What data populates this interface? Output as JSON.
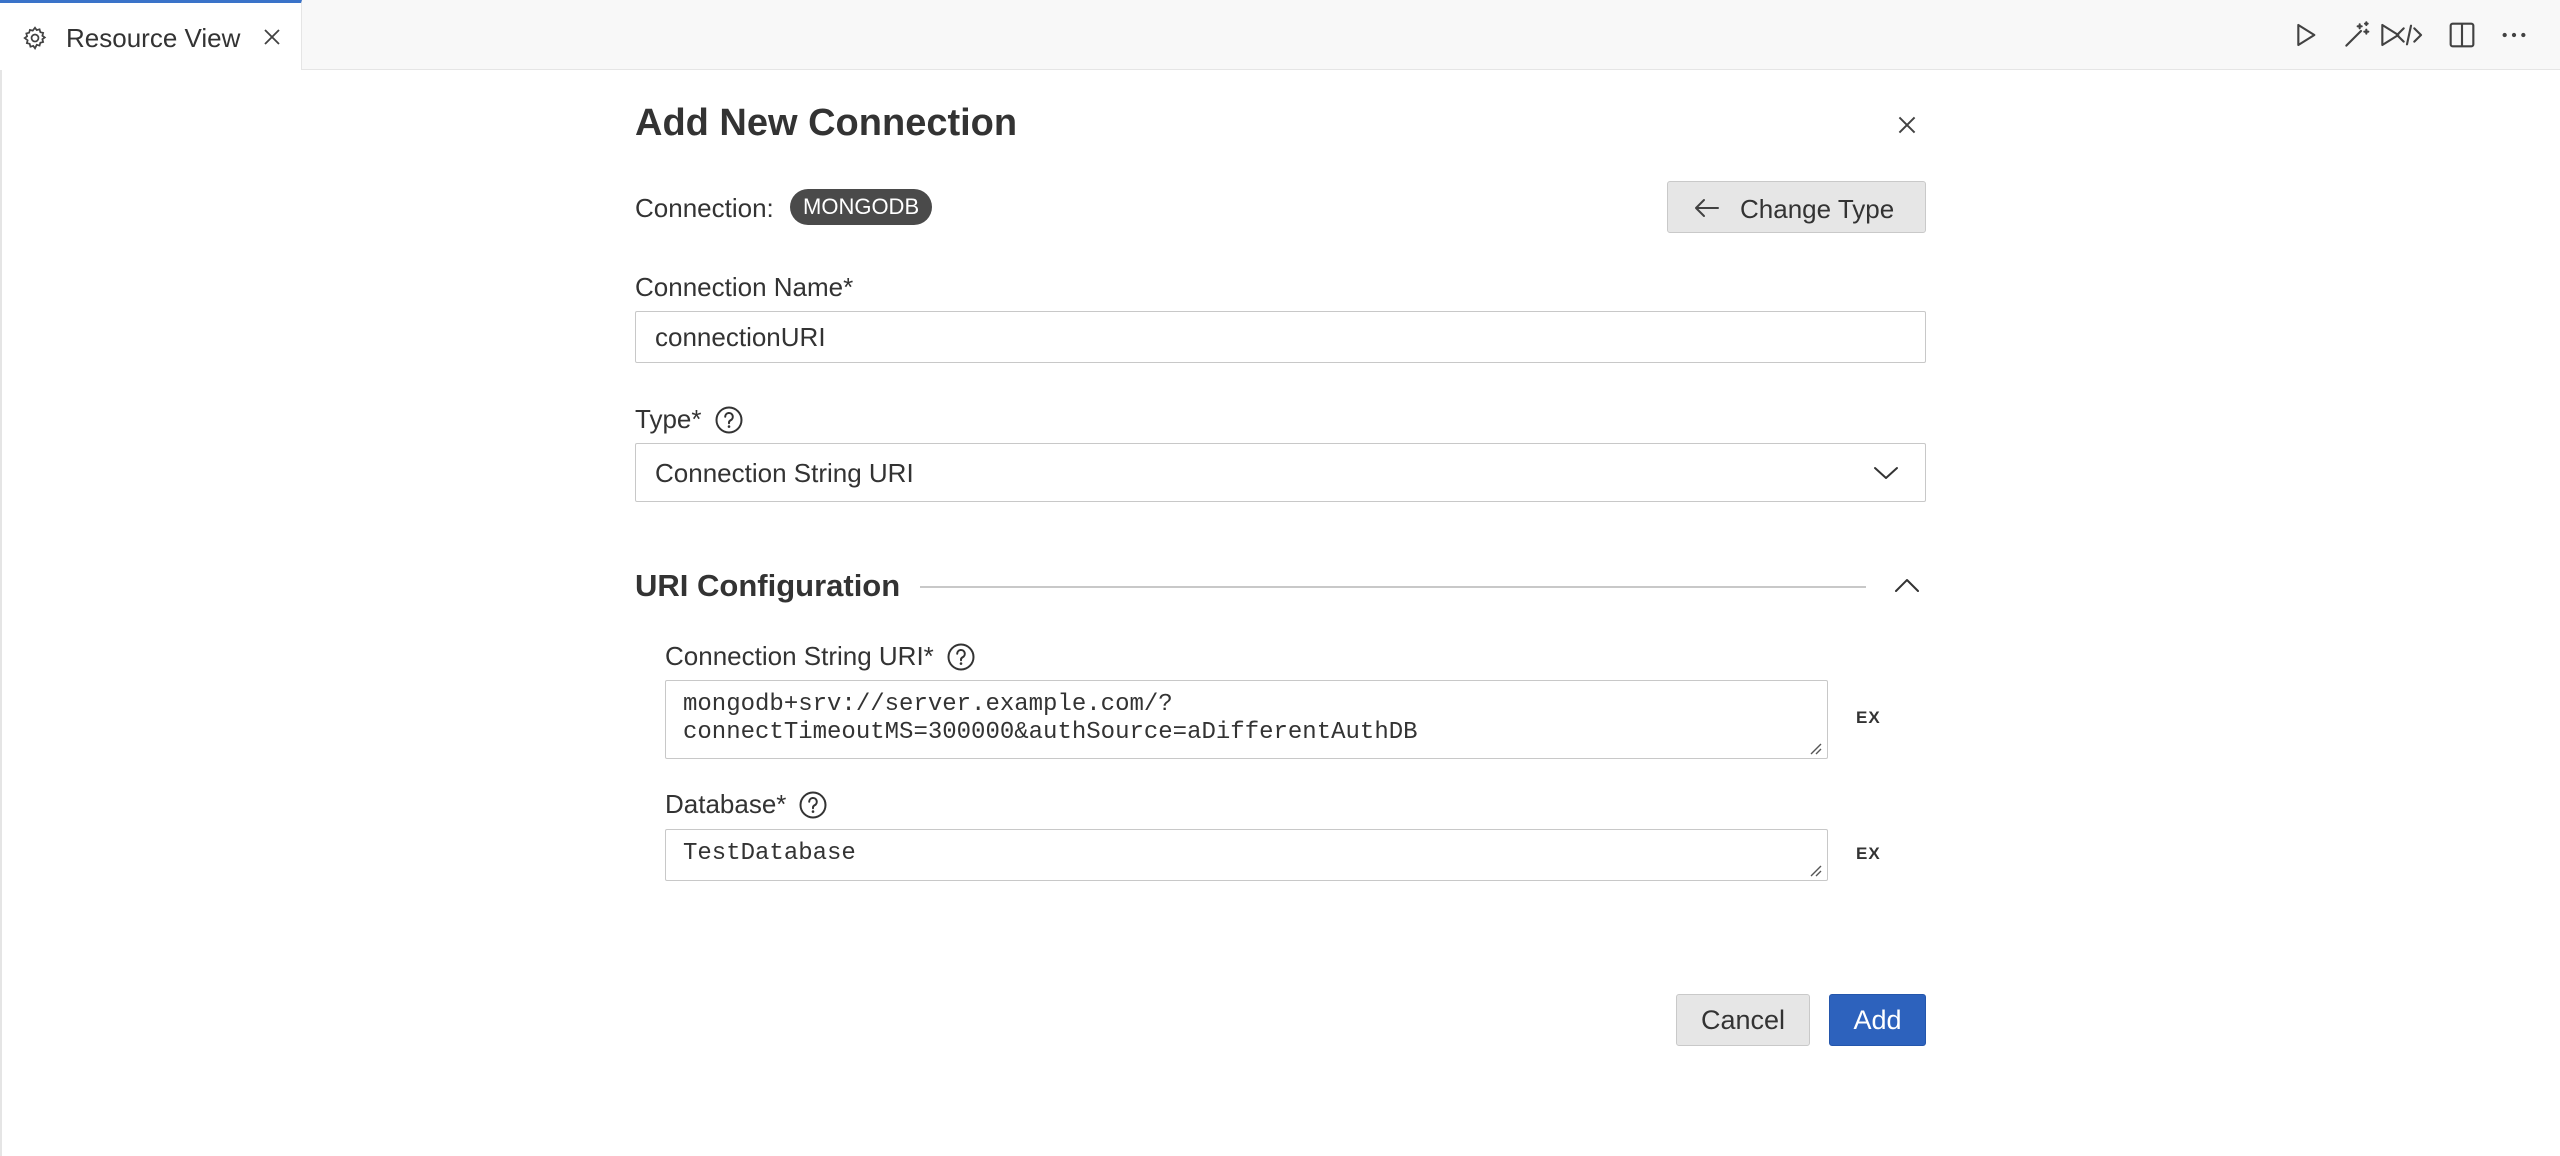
{
  "tab": {
    "label": "Resource View",
    "icon": "gear-icon",
    "close_icon": "close-icon"
  },
  "toolbar_actions": [
    {
      "name": "run-icon"
    },
    {
      "name": "magic-wand-icon"
    },
    {
      "name": "code-icon"
    },
    {
      "name": "split-editor-icon"
    },
    {
      "name": "more-icon"
    }
  ],
  "dialog": {
    "title": "Add New Connection",
    "connection_label": "Connection:",
    "connection_type_badge": "MONGODB",
    "change_type_label": "Change Type",
    "connection_name": {
      "label": "Connection Name*",
      "value": "connectionURI"
    },
    "type": {
      "label": "Type*",
      "selected": "Connection String URI"
    },
    "uri_section": {
      "title": "URI Configuration",
      "connection_string": {
        "label": "Connection String URI*",
        "value": "mongodb+srv://server.example.com/?\nconnectTimeoutMS=300000&authSource=aDifferentAuthDB",
        "ex_label": "EX"
      },
      "database": {
        "label": "Database*",
        "value": "TestDatabase",
        "ex_label": "EX"
      }
    },
    "cancel_label": "Cancel",
    "add_label": "Add"
  },
  "colors": {
    "accent": "#2d62bd",
    "tab_indicator": "#3a73c9",
    "badge_bg": "#4a4a4a"
  }
}
